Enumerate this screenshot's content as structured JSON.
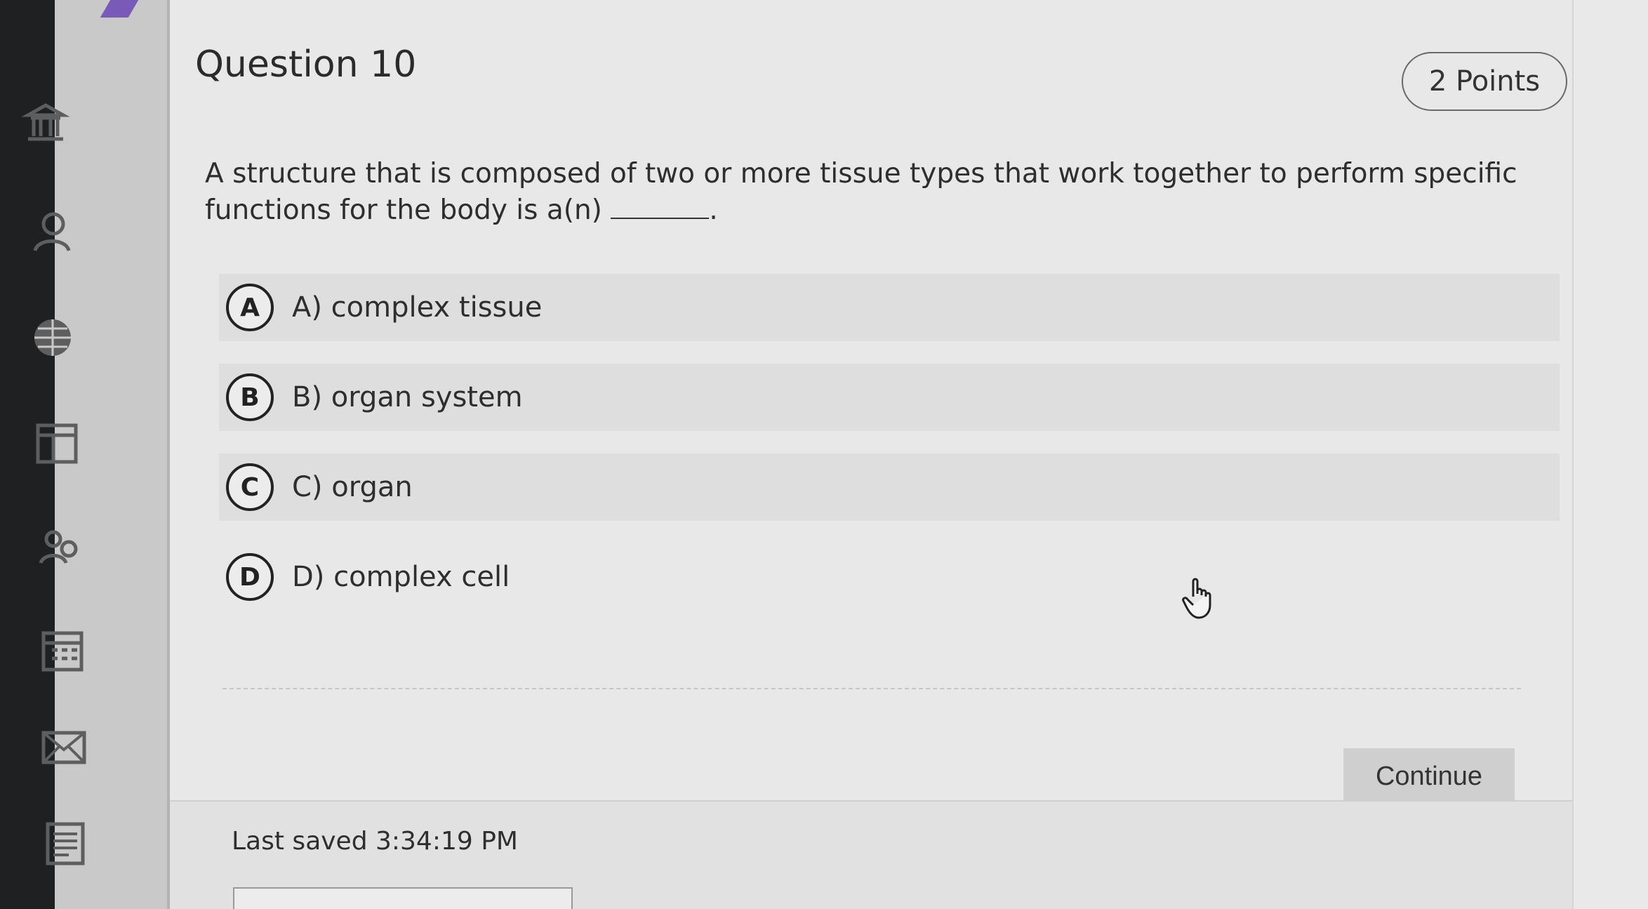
{
  "question": {
    "title": "Question 10",
    "points": "2 Points",
    "prompt_part1": "A structure that is composed of two or more tissue types that work together to perform specific functions for the body is a(n)",
    "prompt_part2": "."
  },
  "options": [
    {
      "letter": "A",
      "label": "A) complex tissue"
    },
    {
      "letter": "B",
      "label": "B) organ system"
    },
    {
      "letter": "C",
      "label": "C) organ"
    },
    {
      "letter": "D",
      "label": "D) complex cell"
    }
  ],
  "actions": {
    "continue_label": "Continue"
  },
  "footer": {
    "last_saved": "Last saved 3:34:19 PM"
  },
  "sidebar": {
    "icons": [
      "institution-icon",
      "user-icon",
      "globe-icon",
      "calendar-board-icon",
      "group-icon",
      "calendar-icon",
      "mail-icon",
      "document-list-icon"
    ]
  }
}
